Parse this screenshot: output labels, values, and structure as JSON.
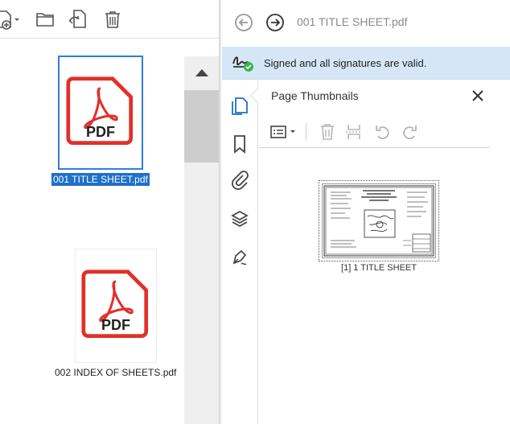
{
  "left_pane": {
    "files": [
      {
        "name": "001 TITLE SHEET.pdf",
        "type_label": "PDF",
        "selected": true
      },
      {
        "name": "002 INDEX OF SHEETS.pdf",
        "type_label": "PDF",
        "selected": false
      }
    ]
  },
  "right_pane": {
    "document_title": "001 TITLE SHEET.pdf",
    "signature_banner": "Signed and all signatures are valid.",
    "panel": {
      "title": "Page Thumbnails",
      "pages": [
        {
          "caption": "[1] 1 TITLE SHEET"
        }
      ]
    }
  },
  "colors": {
    "selection_blue": "#1e70c8",
    "pdf_red": "#e0312b",
    "signature_bg": "#d5e7f7",
    "signature_check": "#3cb34a"
  }
}
